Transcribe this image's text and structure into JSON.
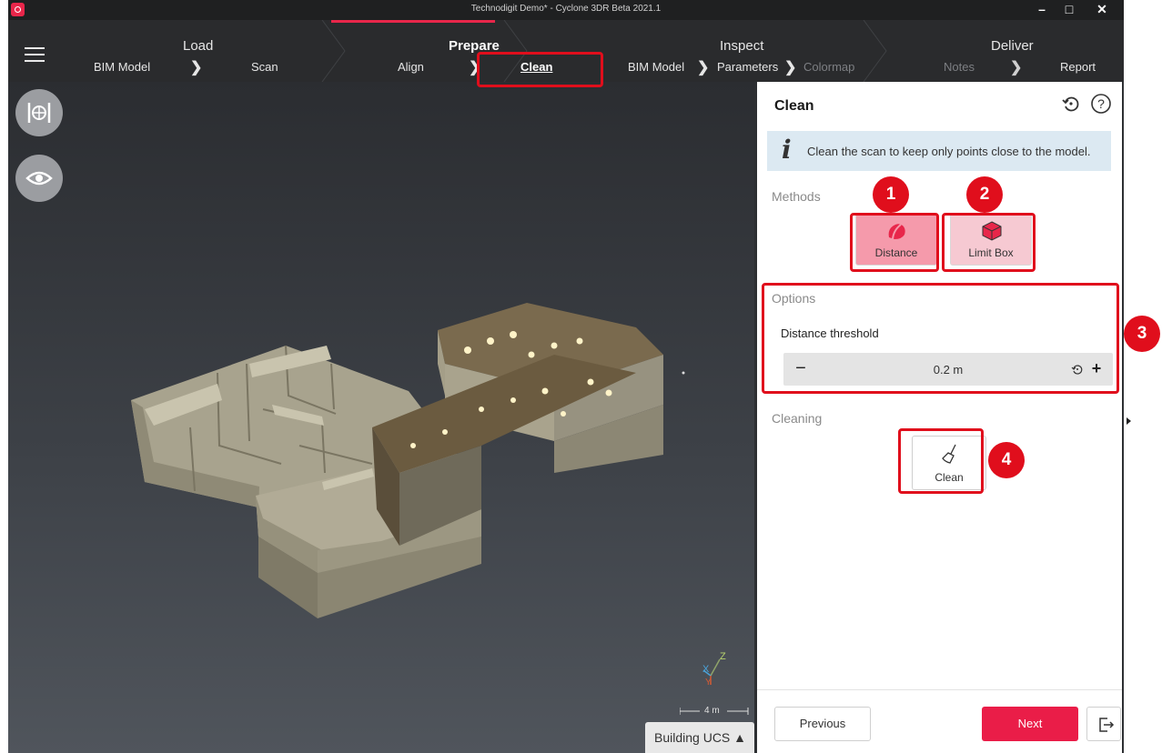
{
  "window": {
    "title": "Technodigit Demo* - Cyclone 3DR Beta 2021.1",
    "controls": [
      "–",
      "□",
      "✕"
    ]
  },
  "workflow": {
    "stages": [
      {
        "title": "Load",
        "steps": [
          "BIM Model",
          "Scan"
        ]
      },
      {
        "title": "Prepare",
        "steps": [
          "Align",
          "Clean"
        ],
        "active": true
      },
      {
        "title": "Inspect",
        "steps": [
          "BIM Model",
          "Parameters",
          "Colormap"
        ]
      },
      {
        "title": "Deliver",
        "steps": [
          "Notes",
          "Report"
        ]
      }
    ],
    "active_step": "Clean",
    "chevron": "❯"
  },
  "viewport": {
    "ucs_label": "Building UCS ▲",
    "scale_label": "4 m",
    "axis_labels": {
      "x": "X",
      "y": "Y",
      "z": "Z"
    },
    "tools": [
      "view-fit-icon",
      "visibility-eye-icon"
    ]
  },
  "panel": {
    "title": "Clean",
    "info": "Clean the scan to keep only points close to the model.",
    "methods_label": "Methods",
    "methods": [
      {
        "label": "Distance",
        "icon": "distance-icon",
        "selected": true
      },
      {
        "label": "Limit Box",
        "icon": "limit-box-icon",
        "selected": false
      }
    ],
    "options_label": "Options",
    "threshold_label": "Distance threshold",
    "threshold_value": "0.2 m",
    "minus": "−",
    "plus": "+",
    "cleaning_label": "Cleaning",
    "clean_button": "Clean",
    "previous": "Previous",
    "next": "Next"
  },
  "annotations": [
    "1",
    "2",
    "3",
    "4"
  ],
  "colors": {
    "accent": "#ea1d48",
    "callout": "#e00e1c",
    "info_bg": "#dce9f2",
    "method_selected": "#f59aab",
    "viewport_top": "#2b2d31",
    "viewport_bottom": "#50555c"
  }
}
